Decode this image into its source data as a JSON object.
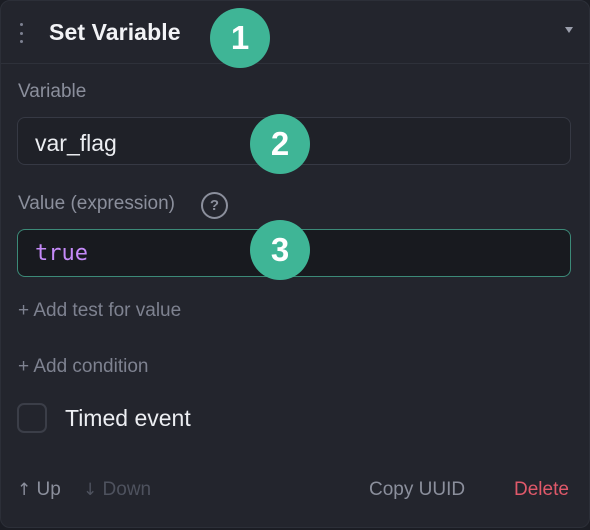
{
  "header": {
    "title": "Set Variable",
    "collapse_icon": "chevron-down-icon"
  },
  "variable": {
    "label": "Variable",
    "value": "var_flag"
  },
  "value_expression": {
    "label": "Value (expression)",
    "help_symbol": "?",
    "value": "true",
    "value_color": "#c58af9"
  },
  "links": {
    "add_test": "+ Add test for value",
    "add_condition": "+ Add condition"
  },
  "timed_event": {
    "label": "Timed event",
    "checked": false
  },
  "footer": {
    "up_arrow": "↑",
    "up_label": "Up",
    "down_arrow": "↓",
    "down_label": "Down",
    "copy_uuid": "Copy UUID",
    "delete": "Delete"
  },
  "badges": [
    "1",
    "2",
    "3"
  ],
  "colors": {
    "accent": "#3fb596",
    "danger": "#e0596a",
    "panel": "#23252d"
  }
}
